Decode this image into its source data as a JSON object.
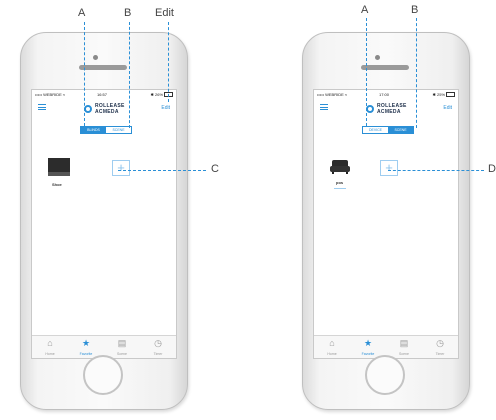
{
  "callouts": {
    "a": "A",
    "b": "B",
    "edit": "Edit",
    "c": "C",
    "d": "D"
  },
  "app": {
    "status_carrier": "••••• WEBRIDE ≈",
    "logo_line1": "ROLLEASE",
    "logo_line2": "ACMEDA",
    "edit": "Edit"
  },
  "phone1": {
    "time": "16:57",
    "battery": "✱ 26%",
    "segments": {
      "a": "BLINDS",
      "b": "SCENE",
      "active": "a"
    },
    "item_label": "Shoe"
  },
  "phone2": {
    "time": "17:00",
    "battery": "✱ 25%",
    "segments": {
      "a": "DEVICE",
      "b": "SCENE",
      "active": "b"
    },
    "item_label": "pos"
  },
  "tabs": [
    {
      "icon": "home-icon",
      "glyph": "⌂",
      "label": "Home"
    },
    {
      "icon": "star-icon",
      "glyph": "★",
      "label": "Favorite"
    },
    {
      "icon": "scene-icon",
      "glyph": "▤",
      "label": "Scene"
    },
    {
      "icon": "timer-icon",
      "glyph": "◷",
      "label": "Timer"
    }
  ],
  "colors": {
    "accent": "#2a8fd6",
    "callout_line": "#2a8fd6"
  }
}
